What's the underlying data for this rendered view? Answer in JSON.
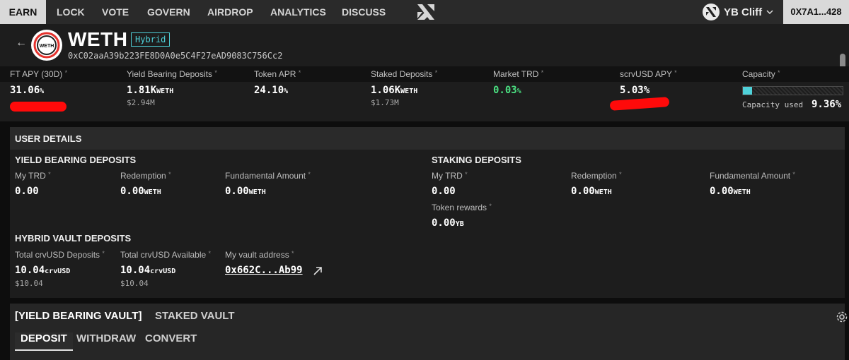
{
  "nav": {
    "items": [
      "EARN",
      "LOCK",
      "VOTE",
      "GOVERN",
      "AIRDROP",
      "ANALYTICS",
      "DISCUSS"
    ],
    "active": "EARN",
    "wallet_name": "YB Cliff",
    "address": "0X7A1...428"
  },
  "header": {
    "token": "WETH",
    "badge": "Hybrid",
    "address": "0xC02aaA39b223FE8D0A0e5C4F27eAD9083C756Cc2",
    "logo_text": "WETH"
  },
  "stats": {
    "ft_apy": {
      "label": "FT APY (30D)",
      "value": "31.06",
      "unit": "%"
    },
    "yield_bearing": {
      "label": "Yield Bearing Deposits",
      "value": "1.81K",
      "unit": "WETH",
      "sub": "$2.94M"
    },
    "token_apr": {
      "label": "Token APR",
      "value": "24.10",
      "unit": "%"
    },
    "staked": {
      "label": "Staked Deposits",
      "value": "1.06K",
      "unit": "WETH",
      "sub": "$1.73M"
    },
    "market_trd": {
      "label": "Market TRD",
      "value": "0.03",
      "unit": "%"
    },
    "scrvusd_apy": {
      "label": "scrvUSD APY",
      "value": "5.03%"
    },
    "capacity": {
      "label": "Capacity",
      "used_label": "Capacity used",
      "used_value": "9.36%",
      "fraction": 0.0936
    }
  },
  "user_details": {
    "title": "USER DETAILS",
    "yield_bearing": {
      "title": "YIELD BEARING DEPOSITS",
      "my_trd": {
        "label": "My TRD",
        "value": "0.00"
      },
      "redemption": {
        "label": "Redemption",
        "value": "0.00",
        "unit": "WETH"
      },
      "fundamental": {
        "label": "Fundamental Amount",
        "value": "0.00",
        "unit": "WETH"
      }
    },
    "staking": {
      "title": "STAKING DEPOSITS",
      "my_trd": {
        "label": "My TRD",
        "value": "0.00"
      },
      "redemption": {
        "label": "Redemption",
        "value": "0.00",
        "unit": "WETH"
      },
      "fundamental": {
        "label": "Fundamental Amount",
        "value": "0.00",
        "unit": "WETH"
      },
      "rewards": {
        "label": "Token rewards",
        "value": "0.00",
        "unit": "YB"
      }
    },
    "hybrid": {
      "title": "HYBRID VAULT DEPOSITS",
      "total_deposits": {
        "label": "Total crvUSD Deposits",
        "value": "10.04",
        "unit": "crvUSD",
        "sub": "$10.04"
      },
      "total_available": {
        "label": "Total crvUSD Available",
        "value": "10.04",
        "unit": "crvUSD",
        "sub": "$10.04"
      },
      "vault_address": {
        "label": "My vault address",
        "value": "0x662C...Ab99"
      }
    }
  },
  "vault": {
    "tabs": [
      "[YIELD BEARING VAULT]",
      "STAKED VAULT"
    ],
    "subtabs": [
      "DEPOSIT",
      "WITHDRAW",
      "CONVERT"
    ]
  },
  "colors": {
    "accent": "#4fd1d9",
    "positive": "#4ade80",
    "redaction": "#ff0a0a"
  },
  "icons": [
    "back-arrow-icon",
    "external-link-icon",
    "gear-icon",
    "chevron-down-icon"
  ]
}
